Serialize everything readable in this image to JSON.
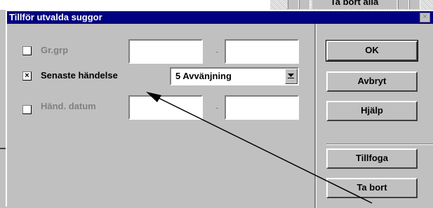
{
  "background": {
    "button_label": "Ta bort alla"
  },
  "dialog": {
    "title": "Tillför utvalda suggor",
    "close_glyph": "×",
    "rows": [
      {
        "label": "Gr.grp",
        "checked": false,
        "enabled": false,
        "from": "",
        "to": "",
        "separator": "-"
      },
      {
        "label": "Senaste händelse",
        "checked": true,
        "enabled": true,
        "selected": "5 Avvänjning"
      },
      {
        "label": "Händ. datum",
        "checked": false,
        "enabled": false,
        "from": "",
        "to": "",
        "separator": "-"
      }
    ],
    "check_glyph": "×",
    "buttons": {
      "ok": "OK",
      "cancel": "Avbryt",
      "help": "Hjälp",
      "append": "Tillfoga",
      "remove": "Ta bort"
    }
  }
}
